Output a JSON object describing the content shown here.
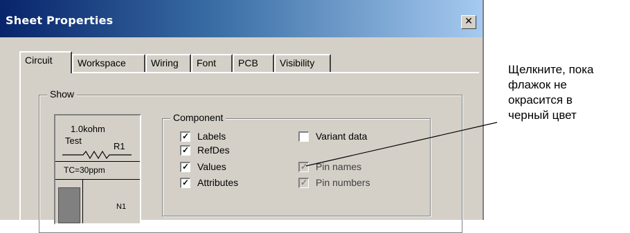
{
  "window": {
    "title": "Sheet Properties",
    "close_glyph": "✕"
  },
  "tabs": [
    {
      "label": "Circuit",
      "active": true
    },
    {
      "label": "Workspace",
      "active": false
    },
    {
      "label": "Wiring",
      "active": false
    },
    {
      "label": "Font",
      "active": false
    },
    {
      "label": "PCB",
      "active": false
    },
    {
      "label": "Visibility",
      "active": false
    }
  ],
  "show_group": {
    "label": "Show"
  },
  "preview": {
    "value": "1.0kohm",
    "name": "Test",
    "refdes": "R1",
    "attribute": "TC=30ppm",
    "node": "N1"
  },
  "component": {
    "label": "Component",
    "checkboxes": [
      {
        "label": "Labels",
        "checked": true,
        "enabled": true
      },
      {
        "label": "RefDes",
        "checked": true,
        "enabled": true
      },
      {
        "label": "Values",
        "checked": true,
        "enabled": true
      },
      {
        "label": "Attributes",
        "checked": true,
        "enabled": true
      },
      {
        "label": "Variant data",
        "checked": false,
        "enabled": true
      },
      {
        "label": "Pin names",
        "checked": true,
        "enabled": false
      },
      {
        "label": "Pin numbers",
        "checked": true,
        "enabled": false
      }
    ]
  },
  "annotation": {
    "lines": [
      "Щелкните, пока",
      "флажок не",
      "окрасится в",
      "черный цвет"
    ]
  }
}
